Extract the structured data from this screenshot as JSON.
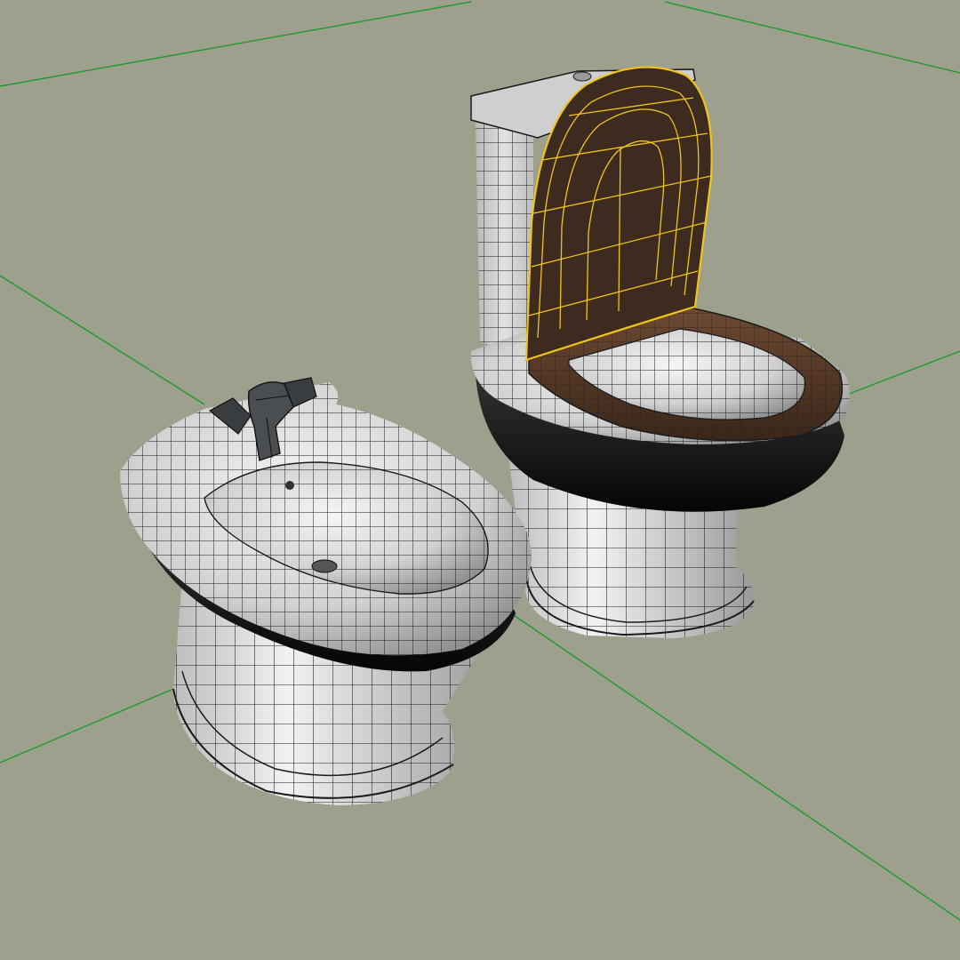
{
  "viewport": {
    "background_color": "#9da08d",
    "grid_color": "#1e9a2e",
    "wire_color": "#1a1a1a",
    "selection_wire_color": "#f0c419"
  },
  "scene": {
    "objects": [
      {
        "id": "bidet",
        "material_color": "#e8e8e8",
        "selected": false
      },
      {
        "id": "bidet-faucet",
        "material_color": "#3a3d40",
        "selected": false
      },
      {
        "id": "toilet",
        "material_color": "#e8e8e8",
        "selected": false
      },
      {
        "id": "toilet-tank",
        "material_color": "#d9d9d9",
        "selected": false
      },
      {
        "id": "toilet-seat",
        "material_color": "#5a3a26",
        "selected": false
      },
      {
        "id": "toilet-lid",
        "material_color": "#3d2b1f",
        "selected": true
      }
    ]
  }
}
